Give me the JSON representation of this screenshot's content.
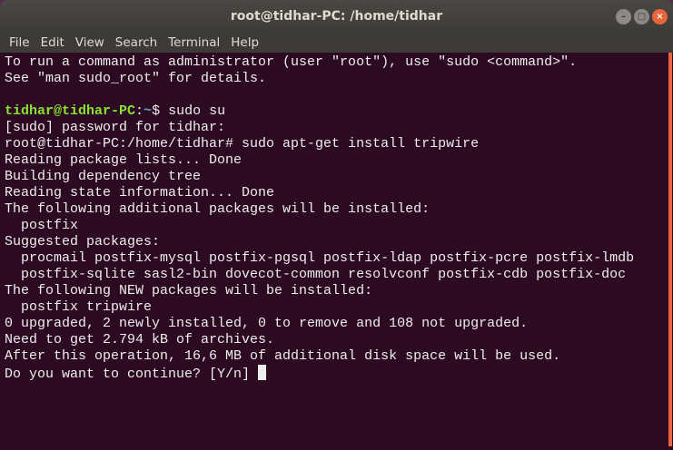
{
  "window": {
    "title": "root@tidhar-PC: /home/tidhar"
  },
  "menu": [
    "File",
    "Edit",
    "View",
    "Search",
    "Terminal",
    "Help"
  ],
  "terminal": {
    "lines_before": [
      "To run a command as administrator (user \"root\"), use \"sudo <command>\".",
      "See \"man sudo_root\" for details.",
      ""
    ],
    "prompt": {
      "user_host": "tidhar@tidhar-PC",
      "sep": ":",
      "path": "~",
      "cmd": "$ sudo su"
    },
    "lines_after": [
      "[sudo] password for tidhar:",
      "root@tidhar-PC:/home/tidhar# sudo apt-get install tripwire",
      "Reading package lists... Done",
      "Building dependency tree",
      "Reading state information... Done",
      "The following additional packages will be installed:",
      "  postfix",
      "Suggested packages:",
      "  procmail postfix-mysql postfix-pgsql postfix-ldap postfix-pcre postfix-lmdb",
      "  postfix-sqlite sasl2-bin dovecot-common resolvconf postfix-cdb postfix-doc",
      "The following NEW packages will be installed:",
      "  postfix tripwire",
      "0 upgraded, 2 newly installed, 0 to remove and 108 not upgraded.",
      "Need to get 2.794 kB of archives.",
      "After this operation, 16,6 MB of additional disk space will be used."
    ],
    "last_prompt": "Do you want to continue? [Y/n] "
  }
}
